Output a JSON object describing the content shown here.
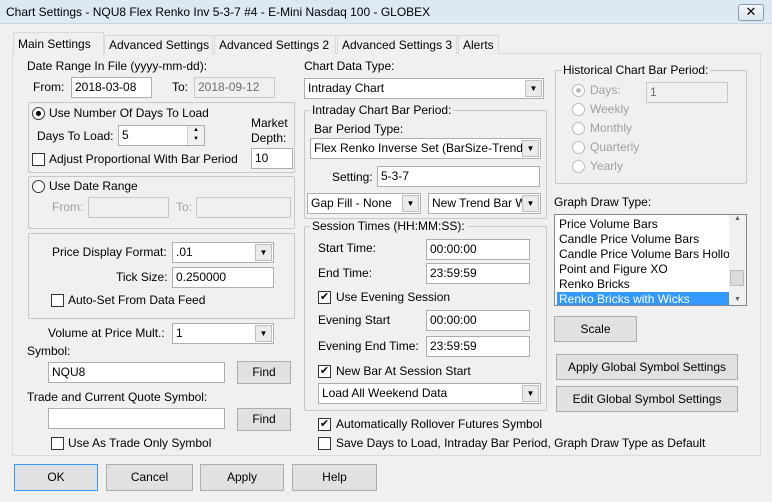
{
  "window": {
    "title": "Chart Settings - NQU8  Flex Renko Inv 5-3-7  #4 - E-Mini Nasdaq 100 - GLOBEX",
    "close_glyph": "✕"
  },
  "tabs": [
    {
      "label": "Main Settings",
      "selected": true
    },
    {
      "label": "Advanced Settings"
    },
    {
      "label": "Advanced Settings 2"
    },
    {
      "label": "Advanced Settings 3"
    },
    {
      "label": "Alerts"
    }
  ],
  "date_range": {
    "label": "Date Range In File (yyyy-mm-dd):",
    "from_label": "From:",
    "from": "2018-03-08",
    "to_label": "To:",
    "to": "2018-09-12"
  },
  "days_group": {
    "radio_label": "Use Number Of Days To Load",
    "selected": true,
    "days_label": "Days To Load:",
    "days": "5",
    "market_depth_label1": "Market",
    "market_depth_label2": "Depth:",
    "market_depth": "10",
    "adjust_label": "Adjust Proportional With Bar Period",
    "adjust_checked": false
  },
  "date_range_group": {
    "radio_label": "Use Date Range",
    "from_label": "From:",
    "to_label": "To:",
    "from": "",
    "to": ""
  },
  "price_group": {
    "format_label": "Price Display Format:",
    "format": ".01",
    "tick_label": "Tick Size:",
    "tick": "0.250000",
    "autoset_label": "Auto-Set From Data Feed"
  },
  "vap": {
    "label": "Volume at Price Mult.:",
    "value": "1"
  },
  "symbol": {
    "label": "Symbol:",
    "value": "NQU8",
    "find": "Find"
  },
  "trade_symbol": {
    "label": "Trade and Current Quote Symbol:",
    "value": "",
    "find": "Find",
    "trade_only_label": "Use As Trade Only Symbol"
  },
  "chart_data_type": {
    "label": "Chart Data Type:",
    "value": "Intraday Chart"
  },
  "intraday": {
    "label": "Intraday Chart Bar Period:",
    "bar_type_label": "Bar Period Type:",
    "bar_type": "Flex Renko Inverse Set (BarSize-Trend",
    "setting_label": "Setting:",
    "setting": "5-3-7",
    "gap_fill": "Gap Fill - None",
    "new_trend": "New Trend Bar W"
  },
  "session": {
    "label": "Session Times (HH:MM:SS):",
    "start_label": "Start Time:",
    "start": "00:00:00",
    "end_label": "End Time:",
    "end": "23:59:59",
    "evening_label": "Use Evening Session",
    "evening_checked": true,
    "evening_start_label": "Evening Start",
    "evening_start": "00:00:00",
    "evening_end_label": "Evening End Time:",
    "evening_end": "23:59:59",
    "newbar_label": "New Bar At Session Start",
    "newbar_checked": true,
    "weekend": "Load All Weekend Data"
  },
  "rollover_label": "Automatically Rollover Futures Symbol",
  "save_default_label": "Save Days to Load, Intraday Bar Period, Graph Draw Type as Default",
  "historical": {
    "label": "Historical Chart Bar Period:",
    "days_label": "Days:",
    "days": "1",
    "weekly": "Weekly",
    "monthly": "Monthly",
    "quarterly": "Quarterly",
    "yearly": "Yearly"
  },
  "graph_draw": {
    "label": "Graph Draw Type:",
    "items": [
      "Price Volume Bars",
      "Candle Price Volume Bars",
      "Candle Price Volume Bars Hollow",
      "Point and Figure XO",
      "Renko Bricks",
      "Renko Bricks with Wicks"
    ],
    "selected": "Renko Bricks with Wicks",
    "selection_color": "#3399ff"
  },
  "buttons": {
    "scale": "Scale",
    "apply_global": "Apply Global Symbol Settings",
    "edit_global": "Edit Global Symbol Settings",
    "ok": "OK",
    "cancel": "Cancel",
    "apply": "Apply",
    "help": "Help"
  },
  "check_glyph": "✔",
  "dropdown_glyph": "▼"
}
